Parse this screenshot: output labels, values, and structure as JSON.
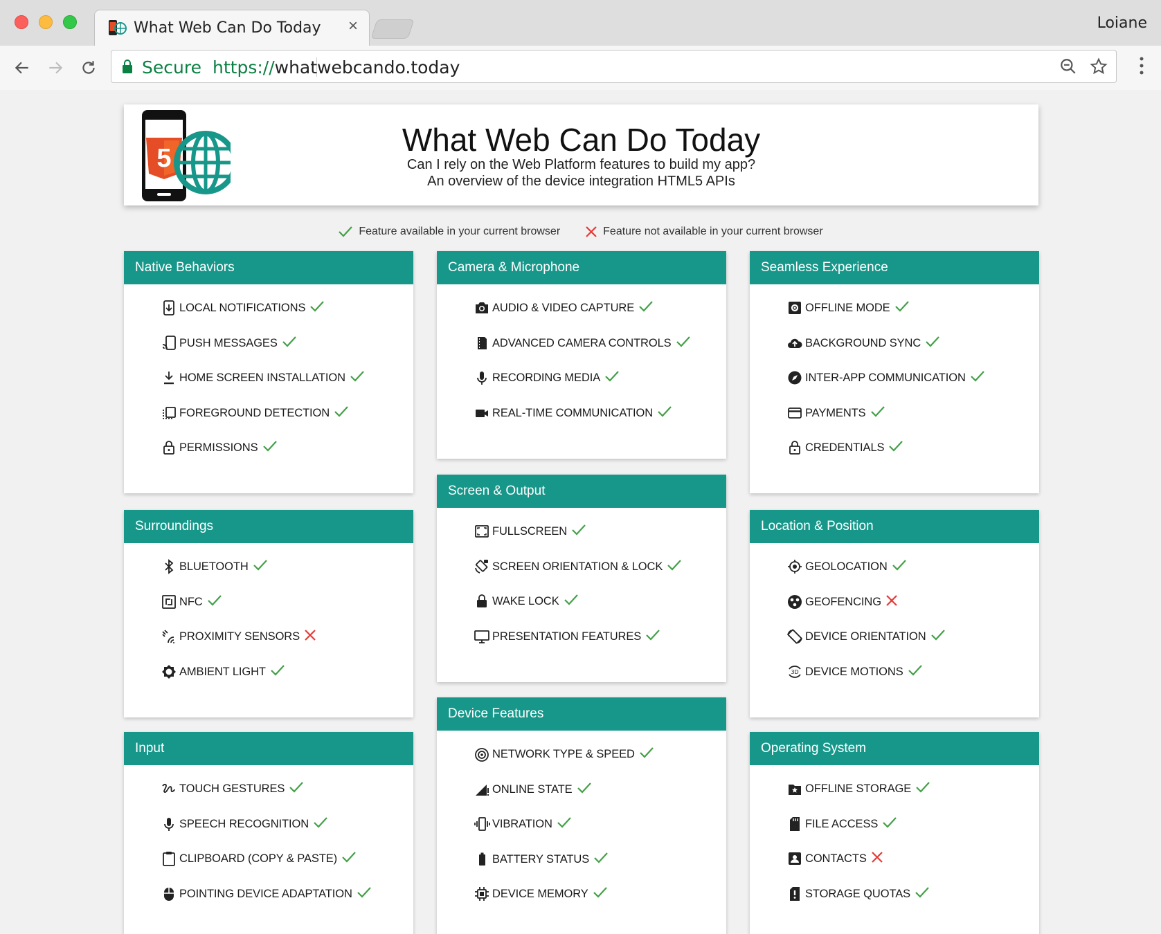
{
  "browser": {
    "tab_title": "What Web Can Do Today",
    "user_name": "Loiane",
    "secure_label": "Secure",
    "url_scheme": "https://",
    "url_host": "whatwebcando.today"
  },
  "header": {
    "title": "What Web Can Do Today",
    "subtitle_line1": "Can I rely on the Web Platform features to build my app?",
    "subtitle_line2": "An overview of the device integration HTML5 APIs",
    "logo_text": "5"
  },
  "legend": {
    "available": "Feature available in your current browser",
    "not_available": "Feature not available in your current browser"
  },
  "colors": {
    "accent": "#16978a",
    "available": "#43a047",
    "unavailable": "#e53935",
    "html5": "#e44d26"
  },
  "categories": [
    {
      "title": "Native Behaviors",
      "items": [
        {
          "label": "Local Notifications",
          "icon": "notification-icon",
          "available": true
        },
        {
          "label": "Push Messages",
          "icon": "push-icon",
          "available": true
        },
        {
          "label": "Home Screen Installation",
          "icon": "download-icon",
          "available": true
        },
        {
          "label": "Foreground Detection",
          "icon": "foreground-icon",
          "available": true
        },
        {
          "label": "Permissions",
          "icon": "lock-icon",
          "available": true
        }
      ]
    },
    {
      "title": "Camera & Microphone",
      "items": [
        {
          "label": "Audio & Video Capture",
          "icon": "camera-icon",
          "available": true
        },
        {
          "label": "Advanced Camera Controls",
          "icon": "film-icon",
          "available": true
        },
        {
          "label": "Recording Media",
          "icon": "microphone-icon",
          "available": true
        },
        {
          "label": "Real-Time Communication",
          "icon": "video-icon",
          "available": true
        }
      ]
    },
    {
      "title": "Seamless Experience",
      "items": [
        {
          "label": "Offline Mode",
          "icon": "gear-icon",
          "available": true
        },
        {
          "label": "Background Sync",
          "icon": "cloud-icon",
          "available": true
        },
        {
          "label": "Inter-App Communication",
          "icon": "compass-icon",
          "available": true
        },
        {
          "label": "Payments",
          "icon": "credit-card-icon",
          "available": true
        },
        {
          "label": "Credentials",
          "icon": "lock-icon",
          "available": true
        }
      ]
    },
    {
      "title": "Surroundings",
      "items": [
        {
          "label": "Bluetooth",
          "icon": "bluetooth-icon",
          "available": true
        },
        {
          "label": "NFC",
          "icon": "nfc-icon",
          "available": true
        },
        {
          "label": "Proximity Sensors",
          "icon": "proximity-icon",
          "available": false
        },
        {
          "label": "Ambient Light",
          "icon": "light-icon",
          "available": true
        }
      ]
    },
    {
      "title": "Screen & Output",
      "items": [
        {
          "label": "Fullscreen",
          "icon": "fullscreen-icon",
          "available": true
        },
        {
          "label": "Screen Orientation & Lock",
          "icon": "rotation-lock-icon",
          "available": true
        },
        {
          "label": "Wake Lock",
          "icon": "padlock-icon",
          "available": true
        },
        {
          "label": "Presentation Features",
          "icon": "monitor-icon",
          "available": true
        }
      ]
    },
    {
      "title": "Location & Position",
      "items": [
        {
          "label": "Geolocation",
          "icon": "crosshair-icon",
          "available": true
        },
        {
          "label": "Geofencing",
          "icon": "geofence-icon",
          "available": false
        },
        {
          "label": "Device Orientation",
          "icon": "rotate-icon",
          "available": true
        },
        {
          "label": "Device Motions",
          "icon": "3d-rotation-icon",
          "available": true
        }
      ]
    },
    {
      "title": "Input",
      "items": [
        {
          "label": "Touch Gestures",
          "icon": "gesture-icon",
          "available": true
        },
        {
          "label": "Speech Recognition",
          "icon": "microphone-icon",
          "available": true
        },
        {
          "label": "Clipboard (Copy & Paste)",
          "icon": "clipboard-icon",
          "available": true
        },
        {
          "label": "Pointing Device Adaptation",
          "icon": "mouse-icon",
          "available": true
        }
      ]
    },
    {
      "title": "Device Features",
      "items": [
        {
          "label": "Network Type & Speed",
          "icon": "network-icon",
          "available": true
        },
        {
          "label": "Online State",
          "icon": "signal-icon",
          "available": true
        },
        {
          "label": "Vibration",
          "icon": "vibration-icon",
          "available": true
        },
        {
          "label": "Battery Status",
          "icon": "battery-icon",
          "available": true
        },
        {
          "label": "Device Memory",
          "icon": "chip-icon",
          "available": true
        }
      ]
    },
    {
      "title": "Operating System",
      "items": [
        {
          "label": "Offline Storage",
          "icon": "storage-icon",
          "available": true
        },
        {
          "label": "File Access",
          "icon": "sd-card-icon",
          "available": true
        },
        {
          "label": "Contacts",
          "icon": "contact-icon",
          "available": false
        },
        {
          "label": "Storage Quotas",
          "icon": "quota-icon",
          "available": true
        }
      ]
    }
  ]
}
